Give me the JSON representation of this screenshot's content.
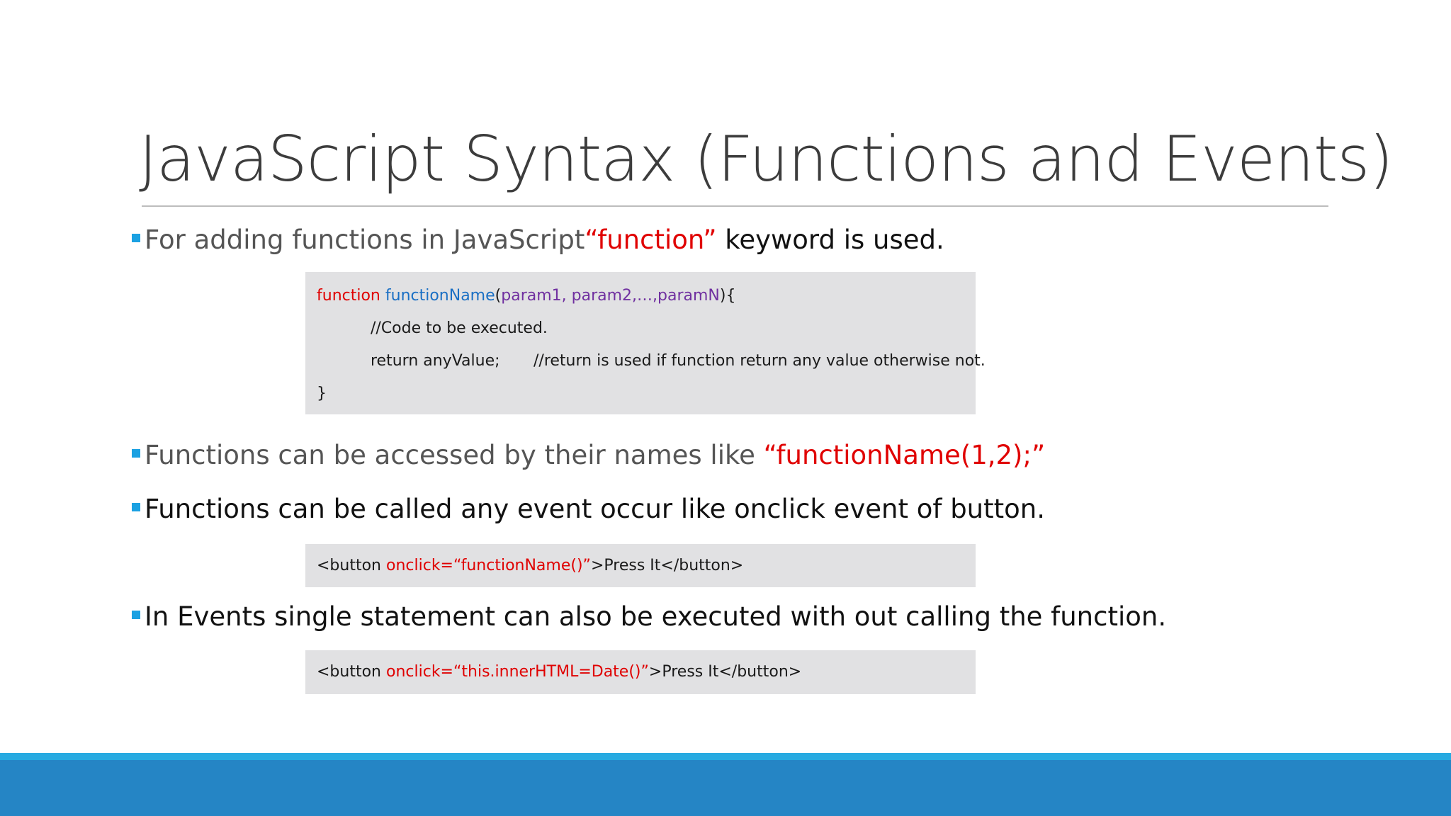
{
  "slide": {
    "title": "JavaScript Syntax (Functions and Events)",
    "bullets": [
      {
        "prefix": "For adding functions in JavaScript ",
        "highlight": "“function”",
        "suffix": " keyword is used."
      },
      {
        "prefix": "Functions can be accessed by their names like ",
        "highlight": "“functionName(1,2);”"
      },
      {
        "text": "Functions can be called any event occur like onclick event of button."
      },
      {
        "text": "In Events single statement can also be executed with out calling the function."
      }
    ],
    "code_function": {
      "keyword": "function",
      "name": "functionName",
      "open_paren": "(",
      "params": "param1, param2,…,paramN",
      "close": "){",
      "comment_line": "//Code to be executed.",
      "return_stmt": "return anyValue;",
      "return_comment": "//return is used if function return any value otherwise not.",
      "closing_brace": "}"
    },
    "code_button1": {
      "open": "<button ",
      "attr": "onclick=“functionName()”",
      "rest": ">Press It</button>"
    },
    "code_button2": {
      "open": "<button ",
      "attr": "onclick=“this.innerHTML=Date()”",
      "rest": ">Press It</button>"
    },
    "colors": {
      "bullet_marker": "#1ba1e2",
      "highlight_red": "#e00000",
      "function_name_blue": "#1a6fc4",
      "params_purple": "#7030a0",
      "code_background": "#e1e1e3",
      "footer_stripe": "#27aae1",
      "footer_band": "#2585c5"
    }
  }
}
